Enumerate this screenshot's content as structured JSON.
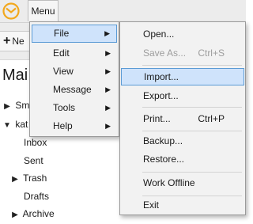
{
  "menubar": {
    "menu_label": "Menu"
  },
  "toolbar": {
    "new_label": "Ne"
  },
  "pane": {
    "title": "Mai"
  },
  "tree": {
    "items": [
      {
        "label": "Sm",
        "twisty": "▶"
      },
      {
        "label": "kat",
        "twisty": "▼"
      },
      {
        "label": "Inbox"
      },
      {
        "label": "Sent"
      },
      {
        "label": "Trash",
        "twisty": "▶"
      },
      {
        "label": "Drafts"
      },
      {
        "label": "Archive",
        "twisty": "▶"
      }
    ]
  },
  "main_menu": {
    "items": [
      {
        "label": "File"
      },
      {
        "label": "Edit"
      },
      {
        "label": "View"
      },
      {
        "label": "Message"
      },
      {
        "label": "Tools"
      },
      {
        "label": "Help"
      }
    ],
    "arrow": "▶"
  },
  "file_menu": {
    "items": [
      {
        "label": "Open..."
      },
      {
        "label": "Save As...",
        "shortcut": "Ctrl+S"
      },
      {
        "label": "Import..."
      },
      {
        "label": "Export..."
      },
      {
        "label": "Print...",
        "shortcut": "Ctrl+P"
      },
      {
        "label": "Backup..."
      },
      {
        "label": "Restore..."
      },
      {
        "label": "Work Offline"
      },
      {
        "label": "Exit"
      }
    ]
  },
  "colors": {
    "selection": "#cfe3fb",
    "selection_border": "#5b9bd5",
    "logo": "#f2a81d"
  },
  "icons": {
    "logo": "envelope-logo-icon",
    "submenu": "chevron-right-icon",
    "new": "plus-icon"
  }
}
